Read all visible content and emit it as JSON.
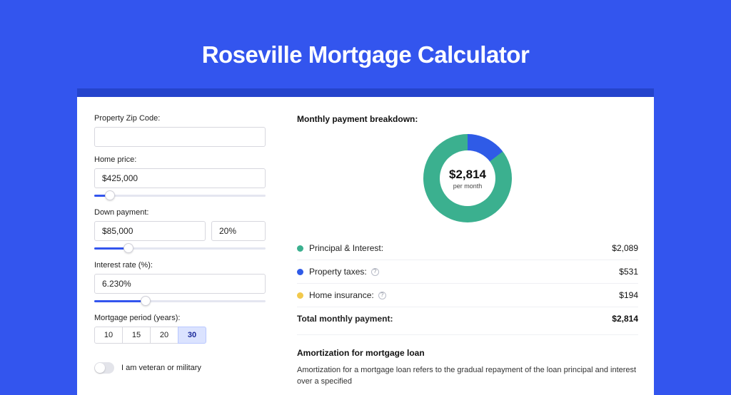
{
  "title": "Roseville Mortgage Calculator",
  "form": {
    "zip_label": "Property Zip Code:",
    "zip_value": "",
    "price_label": "Home price:",
    "price_value": "$425,000",
    "price_slider_pct": 9,
    "down_label": "Down payment:",
    "down_value": "$85,000",
    "down_pct_value": "20%",
    "down_slider_pct": 20,
    "rate_label": "Interest rate (%):",
    "rate_value": "6.230%",
    "rate_slider_pct": 30,
    "period_label": "Mortgage period (years):",
    "period_options": [
      "10",
      "15",
      "20",
      "30"
    ],
    "period_selected": "30",
    "veteran_label": "I am veteran or military"
  },
  "breakdown": {
    "heading": "Monthly payment breakdown:",
    "center_amount": "$2,814",
    "center_sub": "per month",
    "items": [
      {
        "label": "Principal & Interest:",
        "value_text": "$2,089",
        "value_num": 2089,
        "color": "#3bb08f",
        "info": false
      },
      {
        "label": "Property taxes:",
        "value_text": "$531",
        "value_num": 531,
        "color": "#2f5be7",
        "info": true
      },
      {
        "label": "Home insurance:",
        "value_text": "$194",
        "value_num": 194,
        "color": "#f2c94c",
        "info": true
      }
    ],
    "total_label": "Total monthly payment:",
    "total_value": "$2,814"
  },
  "amort": {
    "heading": "Amortization for mortgage loan",
    "text": "Amortization for a mortgage loan refers to the gradual repayment of the loan principal and interest over a specified"
  },
  "chart_data": {
    "type": "pie",
    "title": "Monthly payment breakdown",
    "series": [
      {
        "name": "Principal & Interest",
        "value": 2089,
        "color": "#3bb08f"
      },
      {
        "name": "Property taxes",
        "value": 531,
        "color": "#2f5be7"
      },
      {
        "name": "Home insurance",
        "value": 194,
        "color": "#f2c94c"
      }
    ],
    "total": 2814,
    "center_label": "$2,814 per month"
  }
}
